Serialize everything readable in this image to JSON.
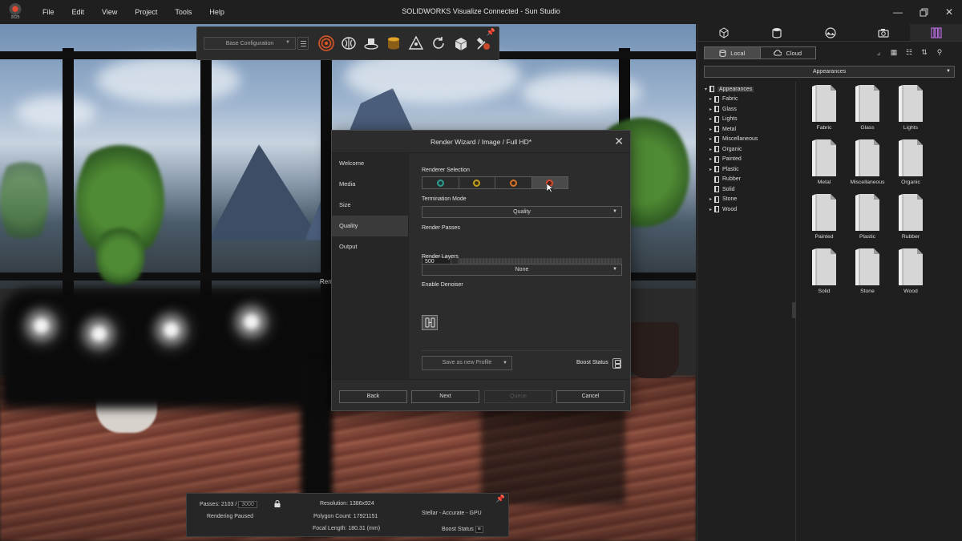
{
  "app": {
    "title": "SOLIDWORKS Visualize Connected - Sun Studio",
    "logo_year": "2025",
    "menu": [
      "File",
      "Edit",
      "View",
      "Project",
      "Tools",
      "Help"
    ],
    "window_controls": [
      "minimize-icon",
      "restore-icon",
      "close-icon"
    ]
  },
  "toolbar": {
    "configuration": "Base Configuration",
    "tools": [
      "render-target-icon",
      "brain-icon",
      "turntable-icon",
      "stack-icon",
      "triangle-node-icon",
      "refresh-icon",
      "cube-icon",
      "tools-icon"
    ]
  },
  "wizard": {
    "title": "Render Wizard / Image / Full HD*",
    "nav": [
      "Welcome",
      "Media",
      "Size",
      "Quality",
      "Output"
    ],
    "active_nav": "Quality",
    "renderer_selection_label": "Renderer Selection",
    "renderers": [
      {
        "name": "preview",
        "color": "#2e9c8e"
      },
      {
        "name": "fast",
        "color": "#c4a21c"
      },
      {
        "name": "accurate",
        "color": "#d4742a"
      },
      {
        "name": "stellar",
        "color": "#d64a2e"
      }
    ],
    "selected_renderer": 3,
    "termination_mode_label": "Termination Mode",
    "termination_mode": "Quality",
    "render_passes_label": "Render Passes",
    "render_passes": "500",
    "render_layers_label": "Render Layers",
    "render_layers": "None",
    "enable_denoiser_label": "Enable Denoiser",
    "save_profile": "Save as new Profile",
    "boost_status": "Boost Status",
    "buttons": {
      "back": "Back",
      "next": "Next",
      "queue": "Queue",
      "cancel": "Cancel"
    }
  },
  "status": {
    "passes_label": "Passes: 2103 /",
    "passes_total": "3000",
    "rendering_state": "Rendering Paused",
    "resolution": "Resolution: 1386x924",
    "polygon_count": "Polygon Count: 17921151",
    "focal_length": "Focal Length: 180.31 (mm)",
    "renderer": "Stellar - Accurate - GPU",
    "boost_status": "Boost Status"
  },
  "viewport": {
    "obscured_label": "Ren"
  },
  "library": {
    "tabs": [
      "models-icon",
      "appearances-icon",
      "environments-icon",
      "cameras-icon",
      "libraries-icon"
    ],
    "active_tab": 4,
    "local_label": "Local",
    "cloud_label": "Cloud",
    "category_dropdown": "Appearances",
    "tree_root": "Appearances",
    "tree": [
      {
        "label": "Fabric",
        "expandable": true
      },
      {
        "label": "Glass",
        "expandable": true
      },
      {
        "label": "Lights",
        "expandable": true
      },
      {
        "label": "Metal",
        "expandable": true
      },
      {
        "label": "Miscellaneous",
        "expandable": true
      },
      {
        "label": "Organic",
        "expandable": true
      },
      {
        "label": "Painted",
        "expandable": true
      },
      {
        "label": "Plastic",
        "expandable": true
      },
      {
        "label": "Rubber",
        "expandable": false
      },
      {
        "label": "Solid",
        "expandable": false
      },
      {
        "label": "Stone",
        "expandable": true
      },
      {
        "label": "Wood",
        "expandable": true
      }
    ],
    "thumbnails": [
      "Fabric",
      "Glass",
      "Lights",
      "Metal",
      "Miscellaneous",
      "Organic",
      "Painted",
      "Plastic",
      "Rubber",
      "Solid",
      "Stone",
      "Wood"
    ]
  }
}
